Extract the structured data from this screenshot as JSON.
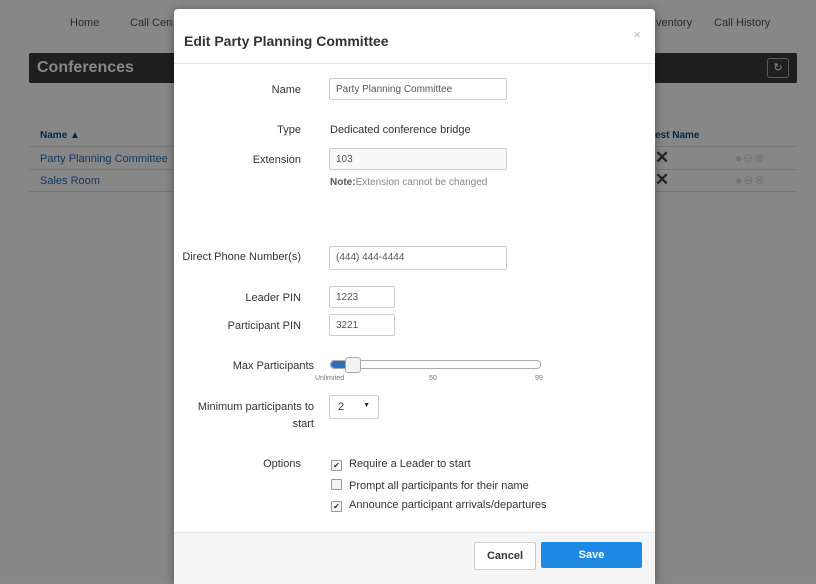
{
  "nav": {
    "home": "Home",
    "call_center": "Call Cen",
    "inventory": "ventory",
    "call_history": "Call History"
  },
  "page": {
    "title": "Conferences",
    "refresh_icon": "refresh-icon",
    "columns": {
      "name": "Name ▲",
      "guest_name": "est Name"
    },
    "rows": [
      {
        "name": "Party Planning Committee"
      },
      {
        "name": "Sales Room"
      }
    ]
  },
  "modal": {
    "title": "Edit Party Planning Committee",
    "close": "×",
    "fields": {
      "name_label": "Name",
      "name_value": "Party Planning Committee",
      "type_label": "Type",
      "type_value": "Dedicated conference bridge",
      "extension_label": "Extension",
      "extension_value": "103",
      "note_prefix": "Note:",
      "note_text": "Extension cannot be changed",
      "direct_label": "Direct Phone Number(s)",
      "direct_value": "(444) 444-4444",
      "leader_pin_label": "Leader PIN",
      "leader_pin_value": "1223",
      "participant_pin_label": "Participant PIN",
      "participant_pin_value": "3221",
      "max_participants_label": "Max Participants",
      "slider_ticks": [
        "Unlimited",
        "50",
        "99"
      ],
      "slider_value_fraction": 0.1,
      "min_participants_label_1": "Minimum participants to",
      "min_participants_label_2": "start",
      "min_participants_value": "2",
      "options_label": "Options"
    },
    "options": [
      {
        "label": "Require a Leader to start",
        "checked": true
      },
      {
        "label": "Prompt all participants for their name",
        "checked": false
      },
      {
        "label": "Announce participant arrivals/departures",
        "checked": true
      }
    ],
    "footer": {
      "cancel": "Cancel",
      "save": "Save"
    }
  },
  "colors": {
    "primary": "#1e88e5",
    "link": "#2a6fb8",
    "header_bg": "#3b3b3b"
  }
}
